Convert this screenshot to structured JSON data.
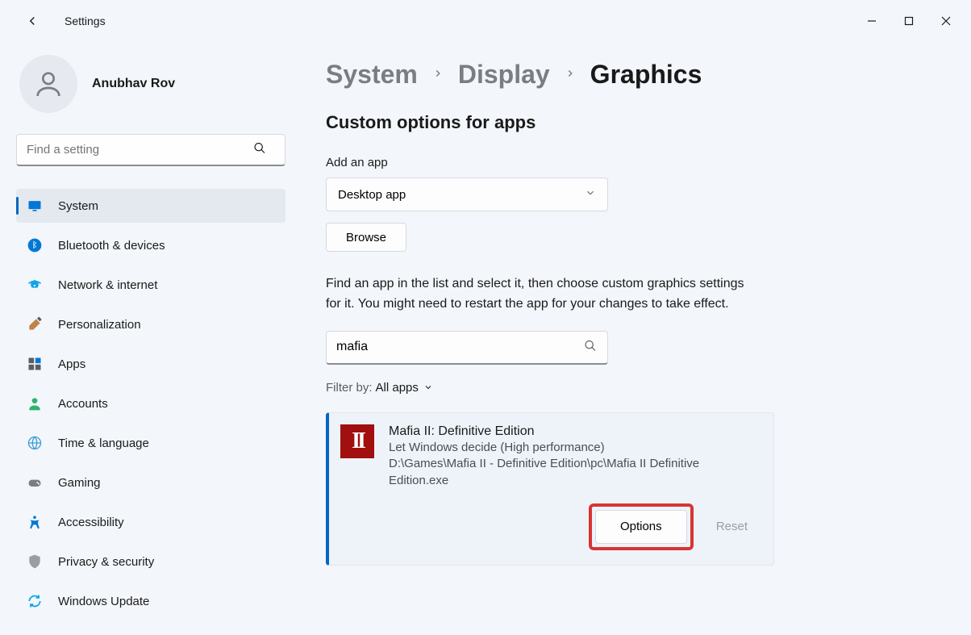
{
  "app_title": "Settings",
  "profile": {
    "name": "Anubhav Rov"
  },
  "search": {
    "placeholder": "Find a setting"
  },
  "nav": {
    "items": [
      {
        "label": "System",
        "icon": "monitor",
        "active": true
      },
      {
        "label": "Bluetooth & devices",
        "icon": "bluetooth"
      },
      {
        "label": "Network & internet",
        "icon": "wifi"
      },
      {
        "label": "Personalization",
        "icon": "brush"
      },
      {
        "label": "Apps",
        "icon": "apps"
      },
      {
        "label": "Accounts",
        "icon": "person"
      },
      {
        "label": "Time & language",
        "icon": "globe"
      },
      {
        "label": "Gaming",
        "icon": "gamepad"
      },
      {
        "label": "Accessibility",
        "icon": "accessibility"
      },
      {
        "label": "Privacy & security",
        "icon": "shield"
      },
      {
        "label": "Windows Update",
        "icon": "update"
      }
    ]
  },
  "breadcrumb": {
    "a": "System",
    "b": "Display",
    "current": "Graphics"
  },
  "section_title": "Custom options for apps",
  "add_app": {
    "label": "Add an app",
    "dropdown_value": "Desktop app",
    "browse_label": "Browse"
  },
  "help_text": "Find an app in the list and select it, then choose custom graphics settings for it. You might need to restart the app for your changes to take effect.",
  "app_search_value": "mafia",
  "filter": {
    "prefix": "Filter by:",
    "value": "All apps"
  },
  "app_card": {
    "name": "Mafia II: Definitive Edition",
    "pref": "Let Windows decide (High performance)",
    "path": "D:\\Games\\Mafia II - Definitive Edition\\pc\\Mafia II Definitive Edition.exe",
    "icon_text": "II",
    "options_label": "Options",
    "reset_label": "Reset"
  }
}
